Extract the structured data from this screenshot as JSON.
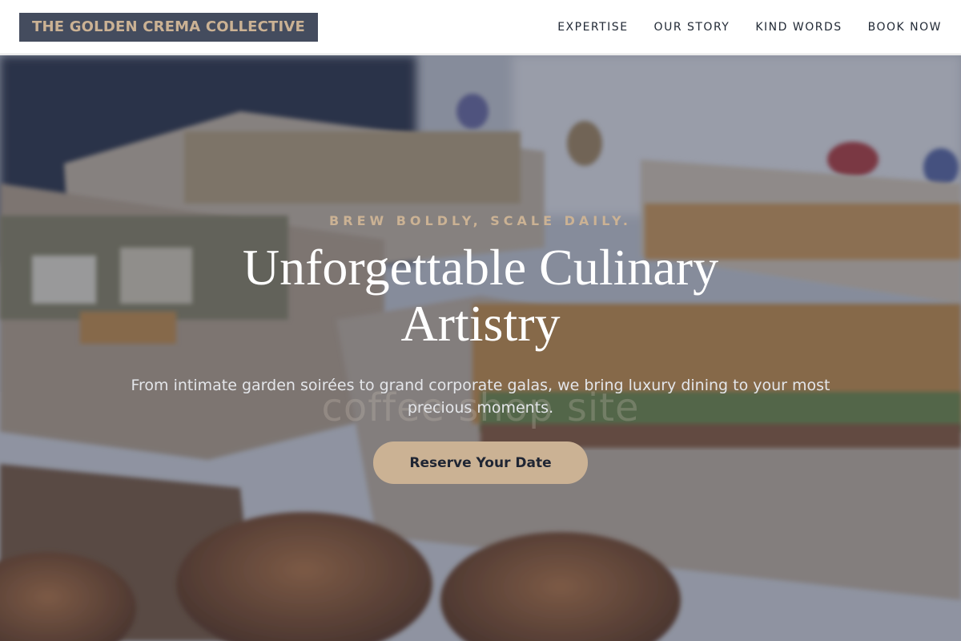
{
  "brand": {
    "name": "THE GOLDEN CREMA COLLECTIVE"
  },
  "nav": {
    "items": [
      {
        "label": "EXPERTISE"
      },
      {
        "label": "OUR STORY"
      },
      {
        "label": "KIND WORDS"
      },
      {
        "label": "BOOK NOW"
      }
    ]
  },
  "hero": {
    "tagline": "BREW BOLDLY, SCALE DAILY.",
    "headline": "Unforgettable Culinary Artistry",
    "watermark": "coffee shop site",
    "subtext": "From intimate garden soirées to grand corporate galas, we bring luxury dining to your most precious moments.",
    "cta_label": "Reserve Your Date",
    "image_description_icon": "catering-boxes-photo"
  },
  "colors": {
    "logo_bg": "#444c5e",
    "accent": "#cbb294",
    "nav_text": "#222a36",
    "hero_overlay": "#2a344e"
  }
}
